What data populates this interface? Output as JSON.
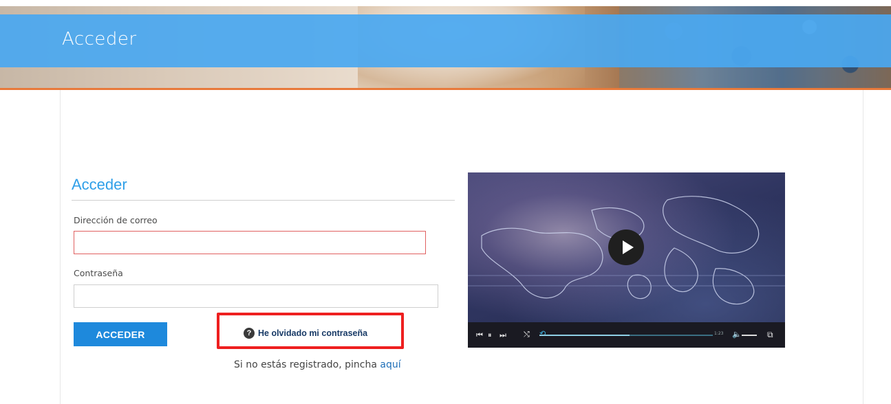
{
  "header": {
    "title": "Acceder"
  },
  "login": {
    "section_title": "Acceder",
    "email_label": "Dirección de correo",
    "email_value": "",
    "password_label": "Contraseña",
    "password_value": "",
    "submit_label": "ACCEDER",
    "forgot_label": "He olvidado mi contraseña",
    "register_prefix": "Si no estás registrado, pincha",
    "register_link": "aquí"
  },
  "video": {
    "time": "1:23",
    "progress": 0.52
  },
  "colors": {
    "header_band": "#4aa8f0",
    "accent_orange": "#e8793a",
    "title_blue": "#2f9fe8",
    "button_blue": "#1e89dc",
    "error_red": "#e06060",
    "highlight_red": "#ee1f1f"
  },
  "icons": {
    "help": "question-circle-icon",
    "play": "play-icon",
    "skip_back": "skip-back-icon",
    "pause": "pause-icon",
    "skip_forward": "skip-forward-icon",
    "shuffle": "shuffle-icon",
    "repeat": "repeat-icon",
    "volume": "volume-icon",
    "popout": "external-link-icon"
  }
}
